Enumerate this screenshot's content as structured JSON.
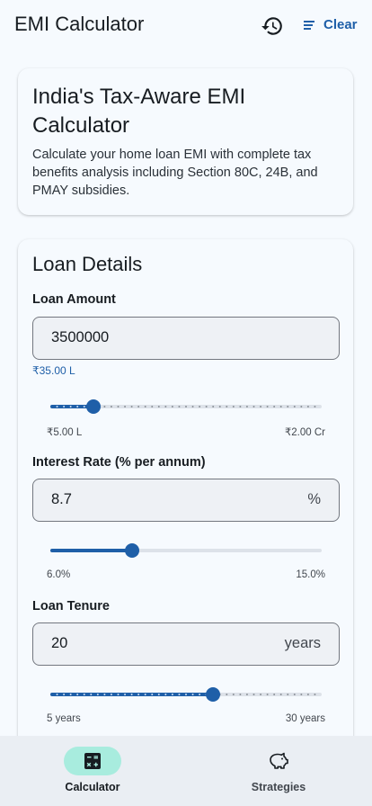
{
  "app": {
    "title": "EMI Calculator",
    "history_icon": "history-icon",
    "clear_icon": "sort-lines-icon",
    "clear_label": "Clear",
    "accent": "#1f5fa8"
  },
  "intro": {
    "heading": "India's Tax-Aware EMI Calculator",
    "description": "Calculate your home loan EMI with complete tax benefits analysis including Section 80C, 24B, and PMAY subsidies."
  },
  "loan": {
    "heading": "Loan Details",
    "amount": {
      "label": "Loan Amount",
      "value": "3500000",
      "helper": "₹35.00 L",
      "min_label": "₹5.00 L",
      "max_label": "₹2.00 Cr",
      "fraction": 0.16
    },
    "rate": {
      "label": "Interest Rate (% per annum)",
      "value": "8.7",
      "suffix": "%",
      "min_label": "6.0%",
      "max_label": "15.0%",
      "fraction": 0.3
    },
    "tenure": {
      "label": "Loan Tenure",
      "value": "20",
      "suffix": "years",
      "min_label": "5 years",
      "max_label": "30 years",
      "fraction": 0.6
    }
  },
  "nav": {
    "items": [
      {
        "label": "Calculator",
        "icon": "calculator-icon",
        "active": true
      },
      {
        "label": "Strategies",
        "icon": "piggy-bank-icon",
        "active": false
      }
    ]
  }
}
